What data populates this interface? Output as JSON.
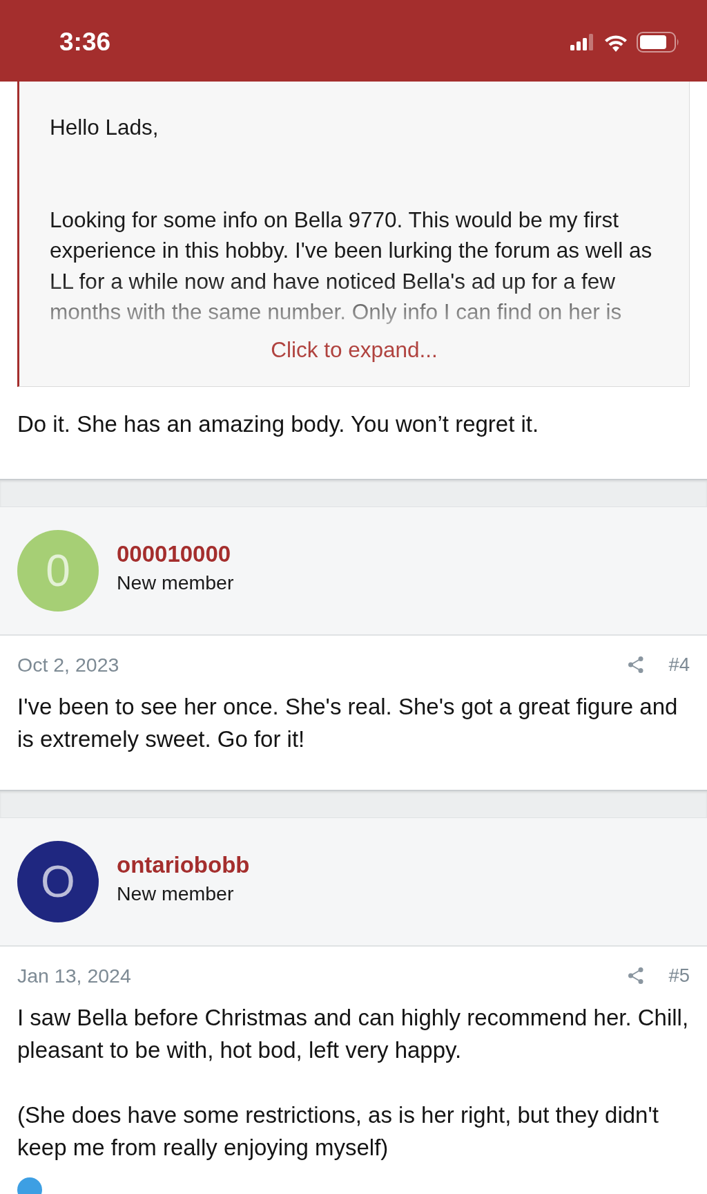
{
  "status_bar": {
    "time": "3:36"
  },
  "quoted_post": {
    "greeting": "Hello Lads,",
    "body": "Looking for some info on Bella 9770. This would be my first experience in this hobby. I've been lurking the forum as well as LL for a while now and have noticed Bella's ad up for a few months with the same number. Only info I can find on her is",
    "expand_link": "Click to expand..."
  },
  "reply_text": "Do it. She has an amazing body. You won’t regret it.",
  "posts": [
    {
      "user": {
        "name": "000010000",
        "role": "New member",
        "avatar_letter": "0",
        "color": "#a6cf75"
      },
      "date": "Oct 2, 2023",
      "post_number": "#4",
      "paragraphs": [
        "I've been to see her once. She's real. She's got a great figure and is extremely sweet. Go for it!"
      ]
    },
    {
      "user": {
        "name": "ontariobobb",
        "role": "New member",
        "avatar_letter": "O",
        "color": "#1f2780"
      },
      "date": "Jan 13, 2024",
      "post_number": "#5",
      "paragraphs": [
        "I saw Bella before Christmas and can highly recommend her. Chill, pleasant to be with, hot bod, left very happy.",
        "(She does have some restrictions, as is her right, but they didn't keep me from really enjoying myself)"
      ]
    }
  ]
}
